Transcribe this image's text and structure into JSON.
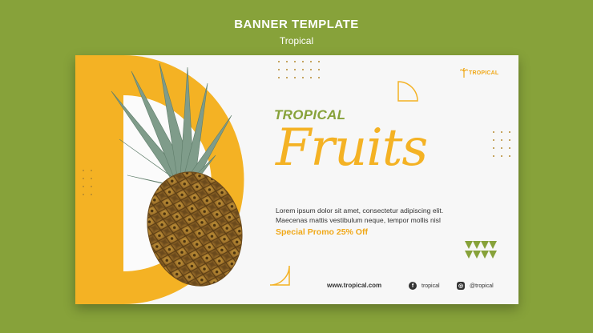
{
  "header": {
    "title": "BANNER TEMPLATE",
    "subtitle": "Tropical"
  },
  "banner": {
    "brand": "TROPICAL",
    "kicker": "TROPICAL",
    "headline": "Fruits",
    "body_line1": "Lorem ipsum dolor sit amet, consectetur adipiscing elit.",
    "body_line2": "Maecenas mattis vestibulum neque, tempor mollis nisl",
    "promo": "Special Promo 25% Off",
    "website": "www.tropical.com",
    "facebook": "tropical",
    "instagram": "@tropical"
  },
  "icons": [
    "palm-tree-icon",
    "facebook-icon",
    "instagram-icon"
  ],
  "colors": {
    "background": "#87a23a",
    "accent_yellow": "#f4b224",
    "accent_green": "#87a23a",
    "banner_bg": "#f7f7f7"
  }
}
